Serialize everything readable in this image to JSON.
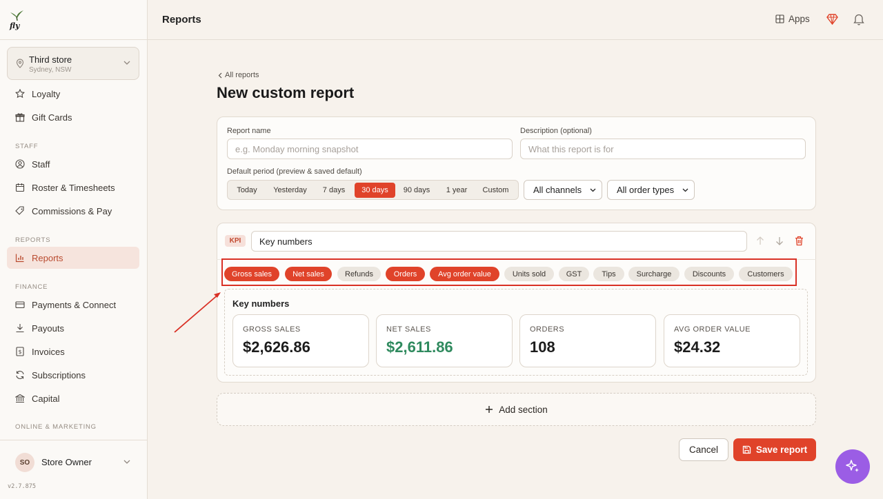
{
  "sidebar": {
    "store": {
      "name": "Third store",
      "location": "Sydney, NSW"
    },
    "items_top": [
      {
        "label": "Loyalty",
        "icon": "star-icon"
      },
      {
        "label": "Gift Cards",
        "icon": "gift-icon"
      }
    ],
    "sections": {
      "staff": "STAFF",
      "reports": "REPORTS",
      "finance": "FINANCE",
      "online": "ONLINE & MARKETING"
    },
    "staff_items": [
      {
        "label": "Staff",
        "icon": "user-circle-icon"
      },
      {
        "label": "Roster & Timesheets",
        "icon": "calendar-icon"
      },
      {
        "label": "Commissions & Pay",
        "icon": "percent-tag-icon"
      }
    ],
    "reports_items": [
      {
        "label": "Reports",
        "icon": "bar-chart-icon",
        "active": true
      }
    ],
    "finance_items": [
      {
        "label": "Payments & Connect",
        "icon": "card-icon"
      },
      {
        "label": "Payouts",
        "icon": "download-icon"
      },
      {
        "label": "Invoices",
        "icon": "invoice-icon"
      },
      {
        "label": "Subscriptions",
        "icon": "refresh-icon"
      },
      {
        "label": "Capital",
        "icon": "bank-icon"
      }
    ],
    "user": {
      "initials": "SO",
      "name": "Store Owner"
    },
    "version": "v2.7.875"
  },
  "topbar": {
    "title": "Reports",
    "apps_label": "Apps"
  },
  "page": {
    "breadcrumb": "All reports",
    "title": "New custom report"
  },
  "form": {
    "report_name_label": "Report name",
    "report_name_placeholder": "e.g. Monday morning snapshot",
    "description_label": "Description (optional)",
    "description_placeholder": "What this report is for",
    "period_label": "Default period (preview & saved default)",
    "periods": [
      "Today",
      "Yesterday",
      "7 days",
      "30 days",
      "90 days",
      "1 year",
      "Custom"
    ],
    "selected_period": "30 days",
    "channel": "All channels",
    "order_type": "All order types"
  },
  "section": {
    "tag": "KPI",
    "name": "Key numbers",
    "metrics": [
      {
        "label": "Gross sales",
        "on": true
      },
      {
        "label": "Net sales",
        "on": true
      },
      {
        "label": "Refunds",
        "on": false
      },
      {
        "label": "Orders",
        "on": true
      },
      {
        "label": "Avg order value",
        "on": true
      },
      {
        "label": "Units sold",
        "on": false
      },
      {
        "label": "GST",
        "on": false
      },
      {
        "label": "Tips",
        "on": false
      },
      {
        "label": "Surcharge",
        "on": false
      },
      {
        "label": "Discounts",
        "on": false
      },
      {
        "label": "Customers",
        "on": false
      }
    ],
    "preview_title": "Key numbers",
    "stats": [
      {
        "label": "GROSS SALES",
        "value": "$2,626.86"
      },
      {
        "label": "NET SALES",
        "value": "$2,611.86",
        "accent": "#2f8a5e"
      },
      {
        "label": "ORDERS",
        "value": "108"
      },
      {
        "label": "AVG ORDER VALUE",
        "value": "$24.32"
      }
    ]
  },
  "actions": {
    "add_section": "Add section",
    "cancel": "Cancel",
    "save": "Save report"
  },
  "colors": {
    "accent": "#e0432a",
    "fab": "#9b5de5",
    "highlight_box": "#d93025"
  }
}
